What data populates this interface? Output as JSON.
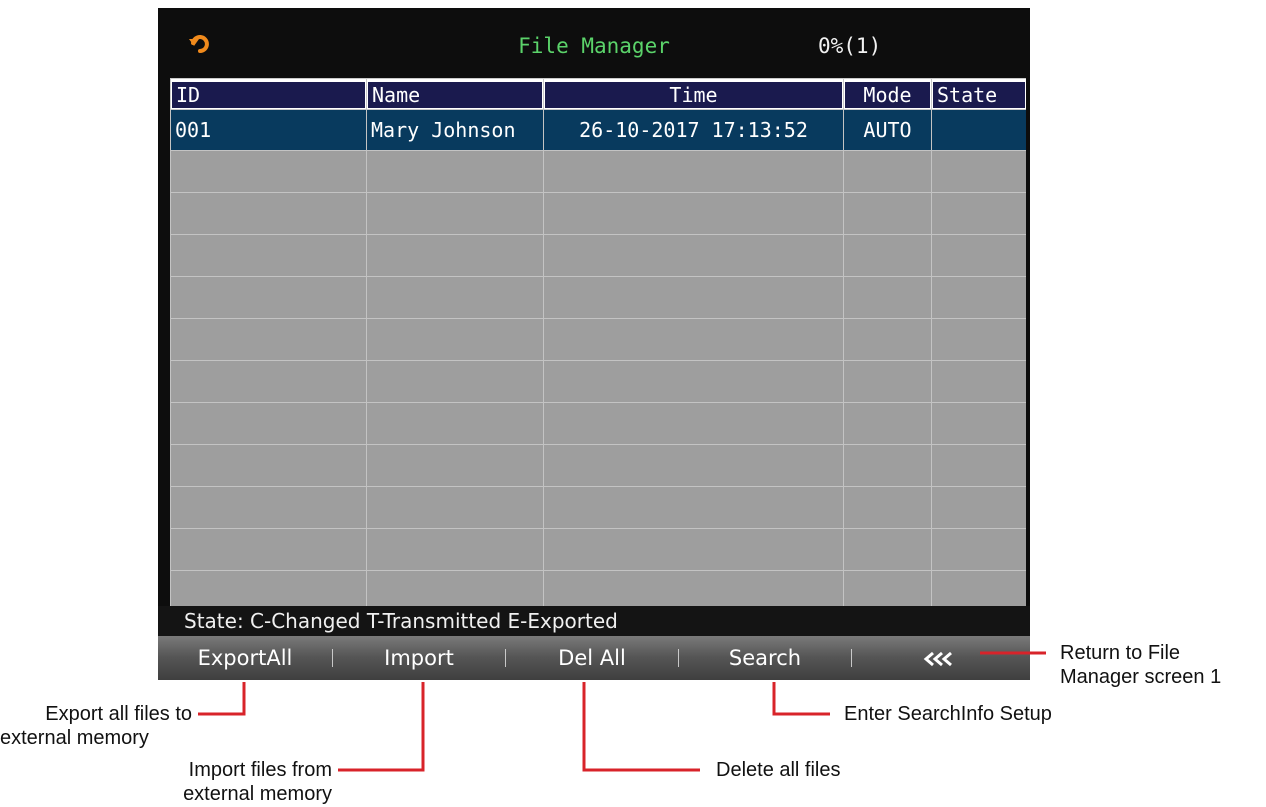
{
  "header": {
    "title": "File Manager",
    "progress": "0%(1)",
    "back_icon": "undo-arrow-icon"
  },
  "table": {
    "columns": [
      "ID",
      "Name",
      "Time",
      "Mode",
      "State"
    ],
    "rows": [
      [
        "001",
        "Mary Johnson",
        "26-10-2017 17:13:52",
        "AUTO",
        ""
      ]
    ],
    "empty_rows": 11
  },
  "status_legend": "State: C-Changed T-Transmitted E-Exported",
  "toolbar": {
    "export_all": "ExportAll",
    "import": "Import",
    "del_all": "Del All",
    "search": "Search",
    "back_icon": "triple-chevron-left-icon"
  },
  "callouts": {
    "return": [
      "Return to File",
      "Manager screen 1"
    ],
    "export": [
      "Export all files to",
      "external memory"
    ],
    "import": [
      "Import files from",
      "external memory"
    ],
    "search": "Enter SearchInfo Setup",
    "delete": "Delete all files"
  },
  "colors": {
    "title": "#5bd36a",
    "header_cell": "#1a1a4e",
    "selected_row": "#083a5e",
    "empty_row": "#9e9e9e",
    "callout_line": "#d8232a"
  }
}
